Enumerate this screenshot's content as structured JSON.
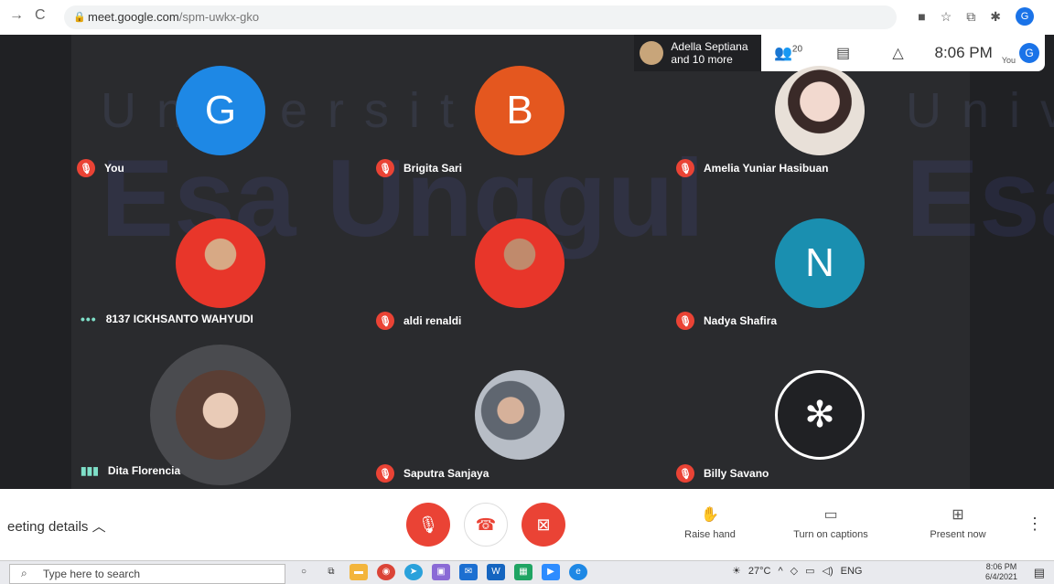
{
  "browser": {
    "url_host": "meet.google.com",
    "url_path": "/spm-uwkx-gko",
    "avatar_letter": "G"
  },
  "watermark": {
    "line1": "Universitas",
    "line2": "Esa Unggul",
    "line3": "Univer",
    "line4": "Esa"
  },
  "topbar": {
    "presenter_name": "Adella Septiana",
    "presenter_more": "and 10 more",
    "participants_count": "20",
    "time": "8:06 PM",
    "you_label": "You",
    "avatar_letter": "G"
  },
  "participants": [
    {
      "name": "You",
      "initial": "G",
      "color": "#1e88e5",
      "status": "muted"
    },
    {
      "name": "Brigita Sari",
      "initial": "B",
      "color": "#e4571f",
      "status": "muted"
    },
    {
      "name": "Amelia Yuniar Hasibuan",
      "initial": "",
      "color": "#e7c9c0",
      "status": "muted"
    },
    {
      "name": "8137 ICKHSANTO WAHYUDI",
      "initial": "",
      "color": "#d93025",
      "status": "speaking-dots"
    },
    {
      "name": "aldi renaldi",
      "initial": "",
      "color": "#d93025",
      "status": "muted"
    },
    {
      "name": "Nadya Shafira",
      "initial": "N",
      "color": "#1a8fb0",
      "status": "muted"
    },
    {
      "name": "Dita Florencia",
      "initial": "",
      "color": "#c9a78f",
      "status": "speaking-bars"
    },
    {
      "name": "Saputra Sanjaya",
      "initial": "",
      "color": "#8a8f9a",
      "status": "muted"
    },
    {
      "name": "Billy Savano",
      "initial": "",
      "color": "#202124",
      "status": "muted"
    }
  ],
  "bottom": {
    "details_label": "eeting details",
    "raise_hand": "Raise hand",
    "captions": "Turn on captions",
    "present": "Present now"
  },
  "taskbar": {
    "search_placeholder": "Type here to search",
    "weather": "27°C",
    "lang": "ENG",
    "time": "8:06 PM",
    "date": "6/4/2021"
  }
}
